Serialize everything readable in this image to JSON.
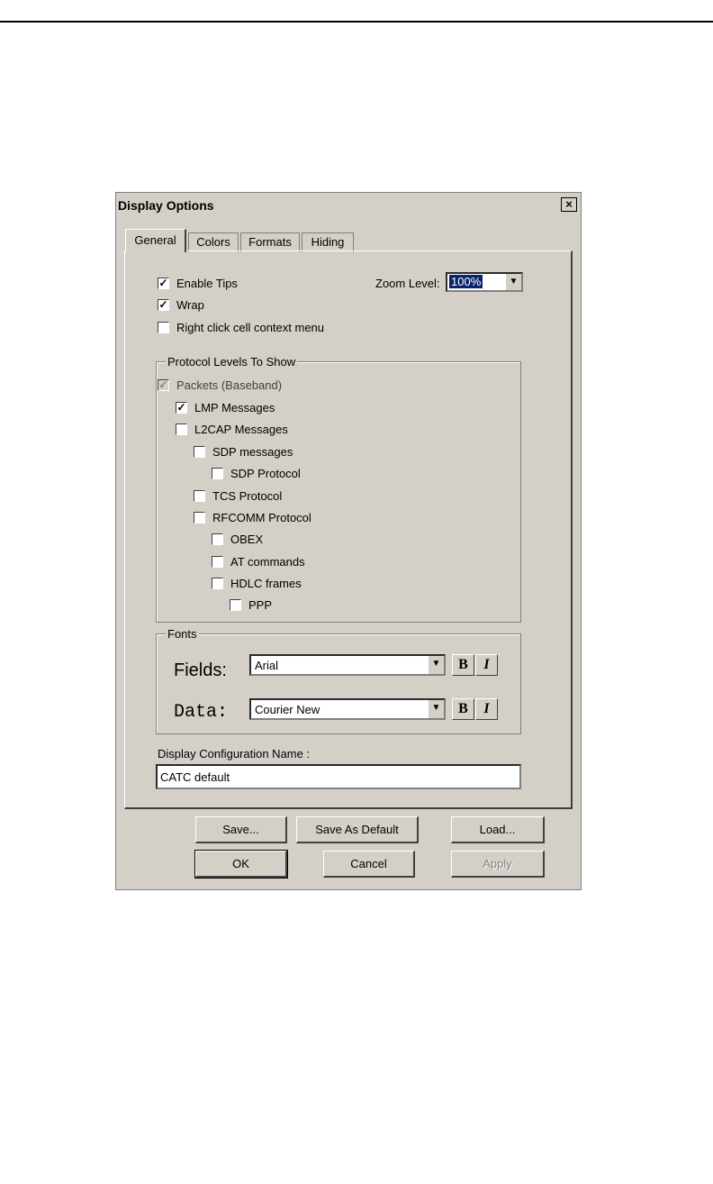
{
  "window": {
    "title": "Display Options",
    "close_symbol": "×"
  },
  "tabs": [
    {
      "label": "General",
      "active": true
    },
    {
      "label": "Colors",
      "active": false
    },
    {
      "label": "Formats",
      "active": false
    },
    {
      "label": "Hiding",
      "active": false
    }
  ],
  "general": {
    "enable_tips": {
      "label": "Enable Tips",
      "checked": true
    },
    "wrap": {
      "label": "Wrap",
      "checked": true
    },
    "right_click": {
      "label": "Right click cell context menu",
      "checked": false
    },
    "zoom_label": "Zoom Level:",
    "zoom_value": "100%"
  },
  "protocol_group": {
    "title": "Protocol Levels To Show",
    "items": [
      {
        "label": "Packets (Baseband)",
        "checked": true,
        "disabled": true
      },
      {
        "label": "LMP Messages",
        "checked": true
      },
      {
        "label": "L2CAP Messages",
        "checked": false
      },
      {
        "label": "SDP messages",
        "checked": false
      },
      {
        "label": "SDP Protocol",
        "checked": false
      },
      {
        "label": "TCS Protocol",
        "checked": false
      },
      {
        "label": "RFCOMM Protocol",
        "checked": false
      },
      {
        "label": "OBEX",
        "checked": false
      },
      {
        "label": "AT commands",
        "checked": false
      },
      {
        "label": "HDLC frames",
        "checked": false
      },
      {
        "label": "PPP",
        "checked": false
      }
    ]
  },
  "fonts_group": {
    "title": "Fonts",
    "fields_label": "Fields:",
    "fields_font": "Arial",
    "data_label": "Data:",
    "data_font": "Courier New",
    "bold": "B",
    "italic": "I"
  },
  "config": {
    "label": "Display Configuration Name :",
    "value": "CATC default"
  },
  "buttons": {
    "save": "Save...",
    "save_default": "Save As Default",
    "load": "Load...",
    "ok": "OK",
    "cancel": "Cancel",
    "apply": "Apply"
  },
  "icons": {
    "check": "✓",
    "dropdown": "▼"
  }
}
